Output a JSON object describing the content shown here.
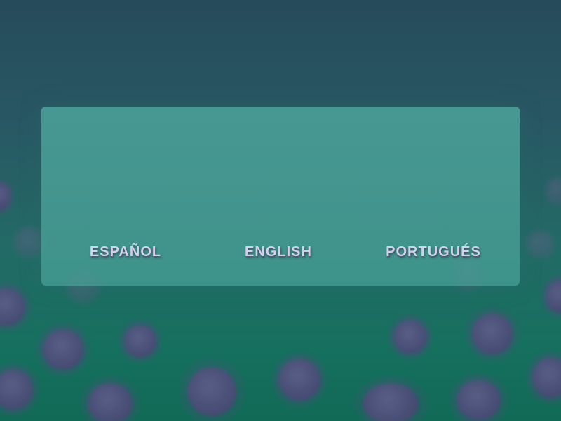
{
  "languages": {
    "spanish_label": "ESPAÑOL",
    "english_label": "ENGLISH",
    "portuguese_label": "PORTUGUÉS"
  },
  "colors": {
    "background_top": "#264b5b",
    "background_bottom": "#116a56",
    "panel": "#4aa096",
    "label_text": "#d6d0ec",
    "virus": "#4f4c7a"
  },
  "background_decoration": "virus-icon pattern"
}
